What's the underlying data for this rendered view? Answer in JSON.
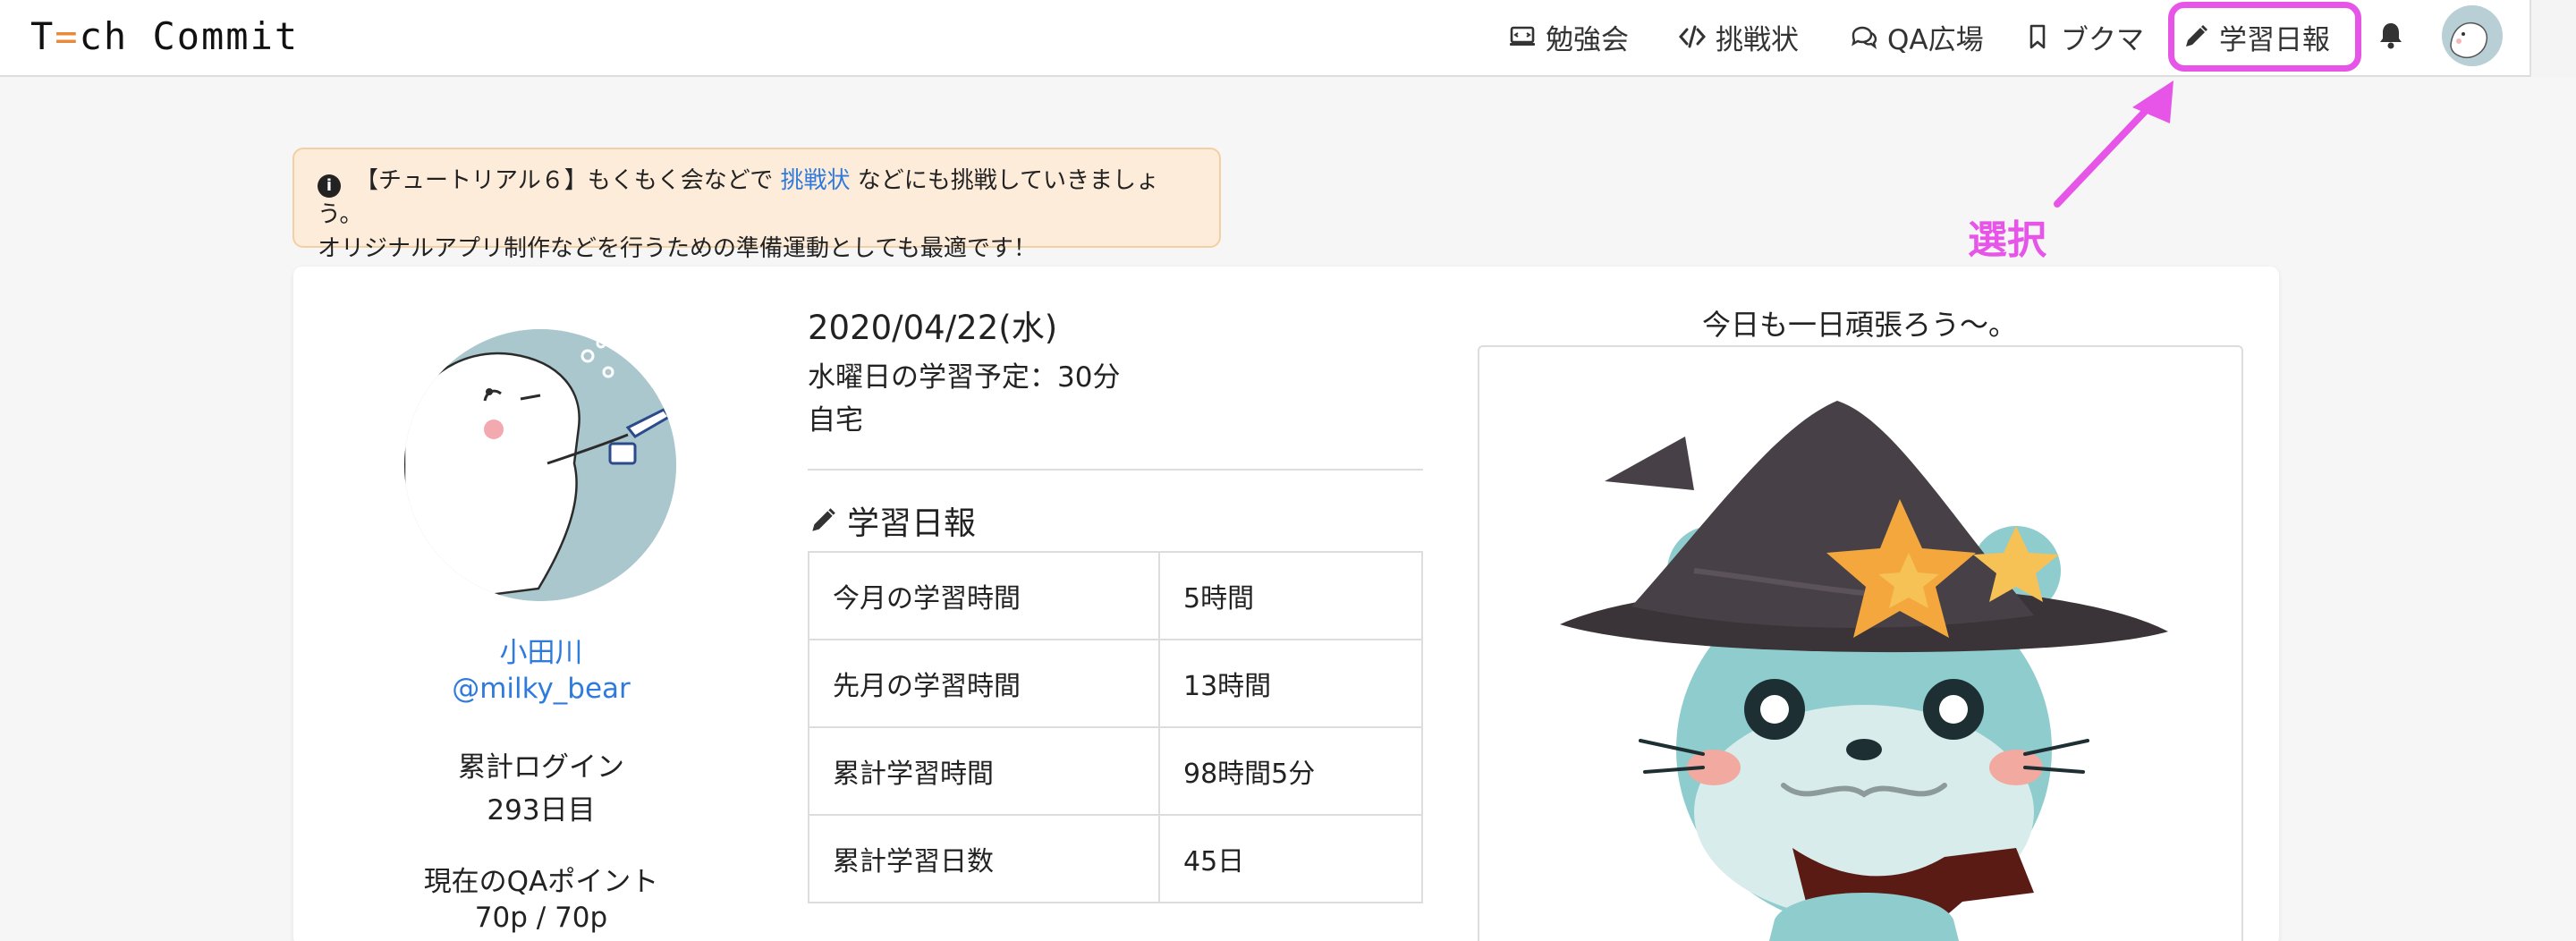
{
  "header": {
    "brand_prefix": "T",
    "brand_accent": "=",
    "brand_suffix": "ch Commit",
    "nav": [
      {
        "label": "勉強会",
        "icon": "laptop-icon"
      },
      {
        "label": "挑戦状",
        "icon": "code-icon"
      },
      {
        "label": "QA広場",
        "icon": "chat-bubbles-icon"
      },
      {
        "label": "ブクマ",
        "icon": "bookmark-icon"
      },
      {
        "label": "学習日報",
        "icon": "pencil-icon"
      }
    ],
    "notification_icon": "bell-icon",
    "avatar_icon": "user-avatar"
  },
  "annotation": {
    "label": "選択",
    "color": "#e655e8"
  },
  "alert": {
    "icon": "info-icon",
    "line1_before": "【チュートリアル６】もくもく会などで ",
    "line1_link": "挑戦状",
    "line1_after": " などにも挑戦していきましょう。",
    "line2": "オリジナルアプリ制作などを行うための準備運動としても最適です！"
  },
  "profile": {
    "name": "小田川",
    "handle": "@milky_bear",
    "login_label": "累計ログイン",
    "login_value": "293日目",
    "qa_label": "現在のQAポイント",
    "qa_value": "70p / 70p"
  },
  "daily": {
    "date": "2020/04/22(水)",
    "plan": "水曜日の学習予定：30分",
    "place": "自宅",
    "section_title": "学習日報",
    "rows": [
      {
        "label": "今月の学習時間",
        "value": "5時間"
      },
      {
        "label": "先月の学習時間",
        "value": "13時間"
      },
      {
        "label": "累計学習時間",
        "value": "98時間5分"
      },
      {
        "label": "累計学習日数",
        "value": "45日"
      }
    ]
  },
  "motto": "今日も一日頑張ろう〜。",
  "colors": {
    "link": "#2f7bdd",
    "brand_accent": "#e8893b",
    "alert_bg": "#fdecd9",
    "highlight": "#e655e8"
  }
}
